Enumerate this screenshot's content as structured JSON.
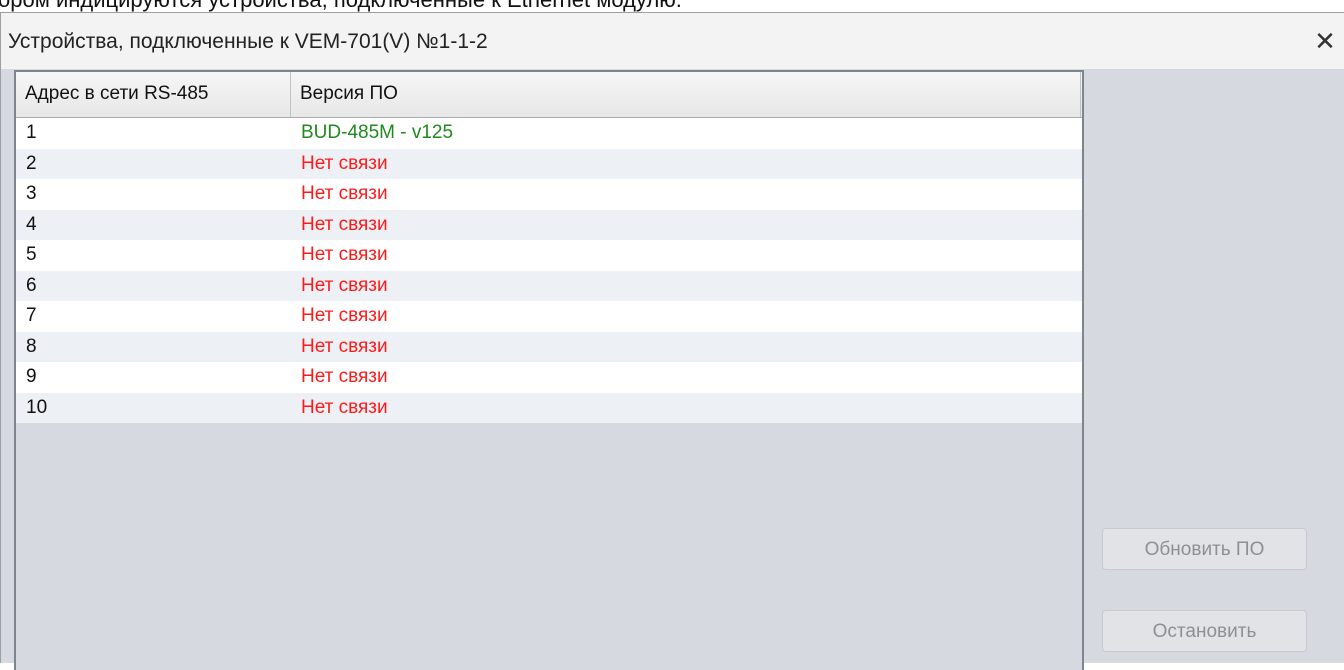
{
  "background_caption": "ором индицируются устройства, подключенные к Ethernet модулю.",
  "dialog": {
    "title": "Устройства, подключенные к VEM-701(V) №1-1-2",
    "close_glyph": "✕"
  },
  "table": {
    "columns": [
      "Адрес в сети RS-485",
      "Версия ПО"
    ],
    "rows": [
      {
        "address": "1",
        "version": "BUD-485M - v125",
        "status_color": "#1f8a1f"
      },
      {
        "address": "2",
        "version": "Нет связи",
        "status_color": "#ff1a1a"
      },
      {
        "address": "3",
        "version": "Нет связи",
        "status_color": "#ff1a1a"
      },
      {
        "address": "4",
        "version": "Нет связи",
        "status_color": "#ff1a1a"
      },
      {
        "address": "5",
        "version": "Нет связи",
        "status_color": "#ff1a1a"
      },
      {
        "address": "6",
        "version": "Нет связи",
        "status_color": "#ff1a1a"
      },
      {
        "address": "7",
        "version": "Нет связи",
        "status_color": "#ff1a1a"
      },
      {
        "address": "8",
        "version": "Нет связи",
        "status_color": "#ff1a1a"
      },
      {
        "address": "9",
        "version": "Нет связи",
        "status_color": "#ff1a1a"
      },
      {
        "address": "10",
        "version": "Нет связи",
        "status_color": "#ff1a1a"
      }
    ]
  },
  "buttons": {
    "update_label": "Обновить ПО",
    "stop_label": "Остановить"
  }
}
